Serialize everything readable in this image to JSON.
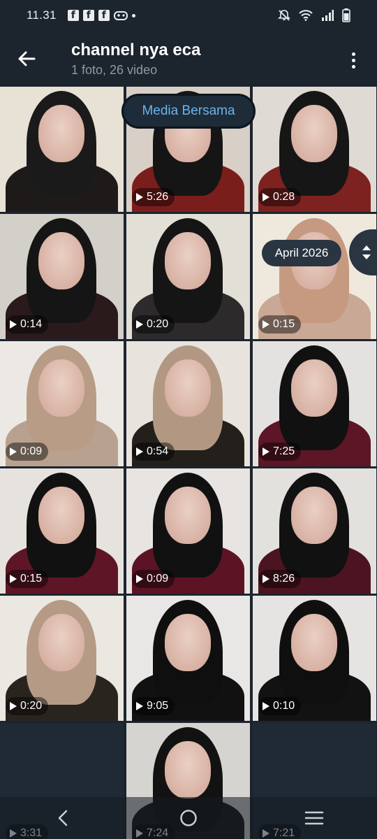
{
  "status_bar": {
    "time": "11.31",
    "app_icons": [
      "facebook-icon",
      "facebook-icon",
      "facebook-icon",
      "game-icon"
    ],
    "right_icons": [
      "mute-icon",
      "wifi-icon",
      "signal-icon",
      "battery-icon"
    ],
    "fb_glyph": "f"
  },
  "header": {
    "title": "channel nya eca",
    "subtitle": "1 foto, 26 video"
  },
  "overlay": {
    "media_label": "Media Bersama",
    "date_label": "April 2026"
  },
  "grid": {
    "items": [
      {
        "duration": "",
        "type": "photo",
        "bg": "#e7e1d6",
        "hijab": "#1a1a1a",
        "body": "#1f1a1a"
      },
      {
        "duration": "5:26",
        "type": "video",
        "bg": "#d8cfc6",
        "hijab": "#151515",
        "body": "#7a1e1c"
      },
      {
        "duration": "0:28",
        "type": "video",
        "bg": "#e0dad4",
        "hijab": "#161616",
        "body": "#7d221f"
      },
      {
        "duration": "0:14",
        "type": "video",
        "bg": "#d3d0c9",
        "hijab": "#151515",
        "body": "#2a1a1c"
      },
      {
        "duration": "0:20",
        "type": "video",
        "bg": "#e2dfd6",
        "hijab": "#151515",
        "body": "#2c2a2a"
      },
      {
        "duration": "0:15",
        "type": "video",
        "bg": "#efe9dd",
        "hijab": "#c69a80",
        "body": "#c9a896"
      },
      {
        "duration": "0:09",
        "type": "video",
        "bg": "#ece9e4",
        "hijab": "#b89c86",
        "body": "#b8a28f"
      },
      {
        "duration": "0:54",
        "type": "video",
        "bg": "#e8e4dd",
        "hijab": "#b29882",
        "body": "#23201c"
      },
      {
        "duration": "7:25",
        "type": "video",
        "bg": "#e4e2e1",
        "hijab": "#111111",
        "body": "#5c1625"
      },
      {
        "duration": "0:15",
        "type": "video",
        "bg": "#e6e3df",
        "hijab": "#111111",
        "body": "#5e1627"
      },
      {
        "duration": "0:09",
        "type": "video",
        "bg": "#e7e4e2",
        "hijab": "#111111",
        "body": "#5c1424"
      },
      {
        "duration": "8:26",
        "type": "video",
        "bg": "#e3e1de",
        "hijab": "#111111",
        "body": "#4c1420"
      },
      {
        "duration": "0:20",
        "type": "video",
        "bg": "#ebe7e1",
        "hijab": "#b59a86",
        "body": "#2a241f"
      },
      {
        "duration": "9:05",
        "type": "video",
        "bg": "#e9e7e5",
        "hijab": "#0f0f0f",
        "body": "#111111"
      },
      {
        "duration": "0:10",
        "type": "video",
        "bg": "#e6e4e2",
        "hijab": "#0f0f0f",
        "body": "#121212"
      },
      {
        "duration": "3:31",
        "type": "video",
        "bg": "#202a35",
        "hijab": "",
        "body": ""
      },
      {
        "duration": "7:24",
        "type": "video",
        "bg": "#d6d4d1",
        "hijab": "#121212",
        "body": "#1a1a1a"
      },
      {
        "duration": "7:21",
        "type": "video",
        "bg": "#202a35",
        "hijab": "",
        "body": ""
      }
    ]
  },
  "navbar": {
    "buttons": [
      "back-nav-icon",
      "home-nav-icon",
      "recents-nav-icon"
    ]
  }
}
